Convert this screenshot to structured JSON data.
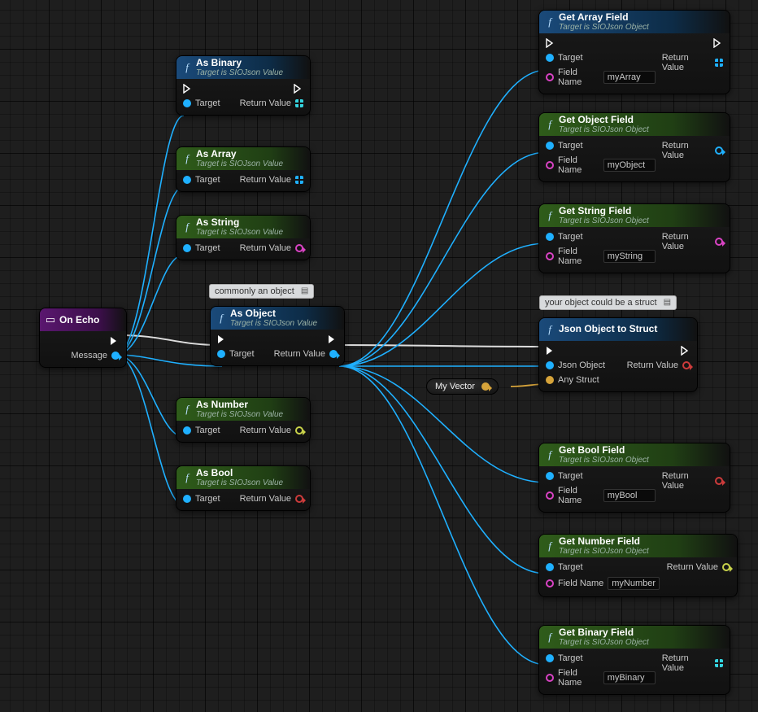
{
  "common": {
    "target_label": "Target",
    "return_value_label": "Return Value",
    "field_name_label": "Field Name",
    "subtitle_value": "Target is SIOJson Value",
    "subtitle_object": "Target is SIOJson Object"
  },
  "comments": {
    "as_object": "commonly an object",
    "struct": "your object could be a struct"
  },
  "variables": {
    "my_vector": "My Vector"
  },
  "event": {
    "title": "On Echo",
    "message_label": "Message"
  },
  "casts": {
    "binary": {
      "title": "As Binary"
    },
    "array": {
      "title": "As Array"
    },
    "string": {
      "title": "As String"
    },
    "object": {
      "title": "As Object"
    },
    "number": {
      "title": "As Number"
    },
    "bool": {
      "title": "As Bool"
    }
  },
  "fields": {
    "array": {
      "title": "Get Array Field",
      "value": "myArray"
    },
    "object": {
      "title": "Get Object Field",
      "value": "myObject"
    },
    "string": {
      "title": "Get String Field",
      "value": "myString"
    },
    "bool": {
      "title": "Get Bool Field",
      "value": "myBool"
    },
    "number": {
      "title": "Get Number Field",
      "value": "myNumber"
    },
    "binary": {
      "title": "Get Binary Field",
      "value": "myBinary"
    }
  },
  "struct_node": {
    "title": "Json Object to Struct",
    "json_object_label": "Json Object",
    "any_struct_label": "Any Struct"
  }
}
